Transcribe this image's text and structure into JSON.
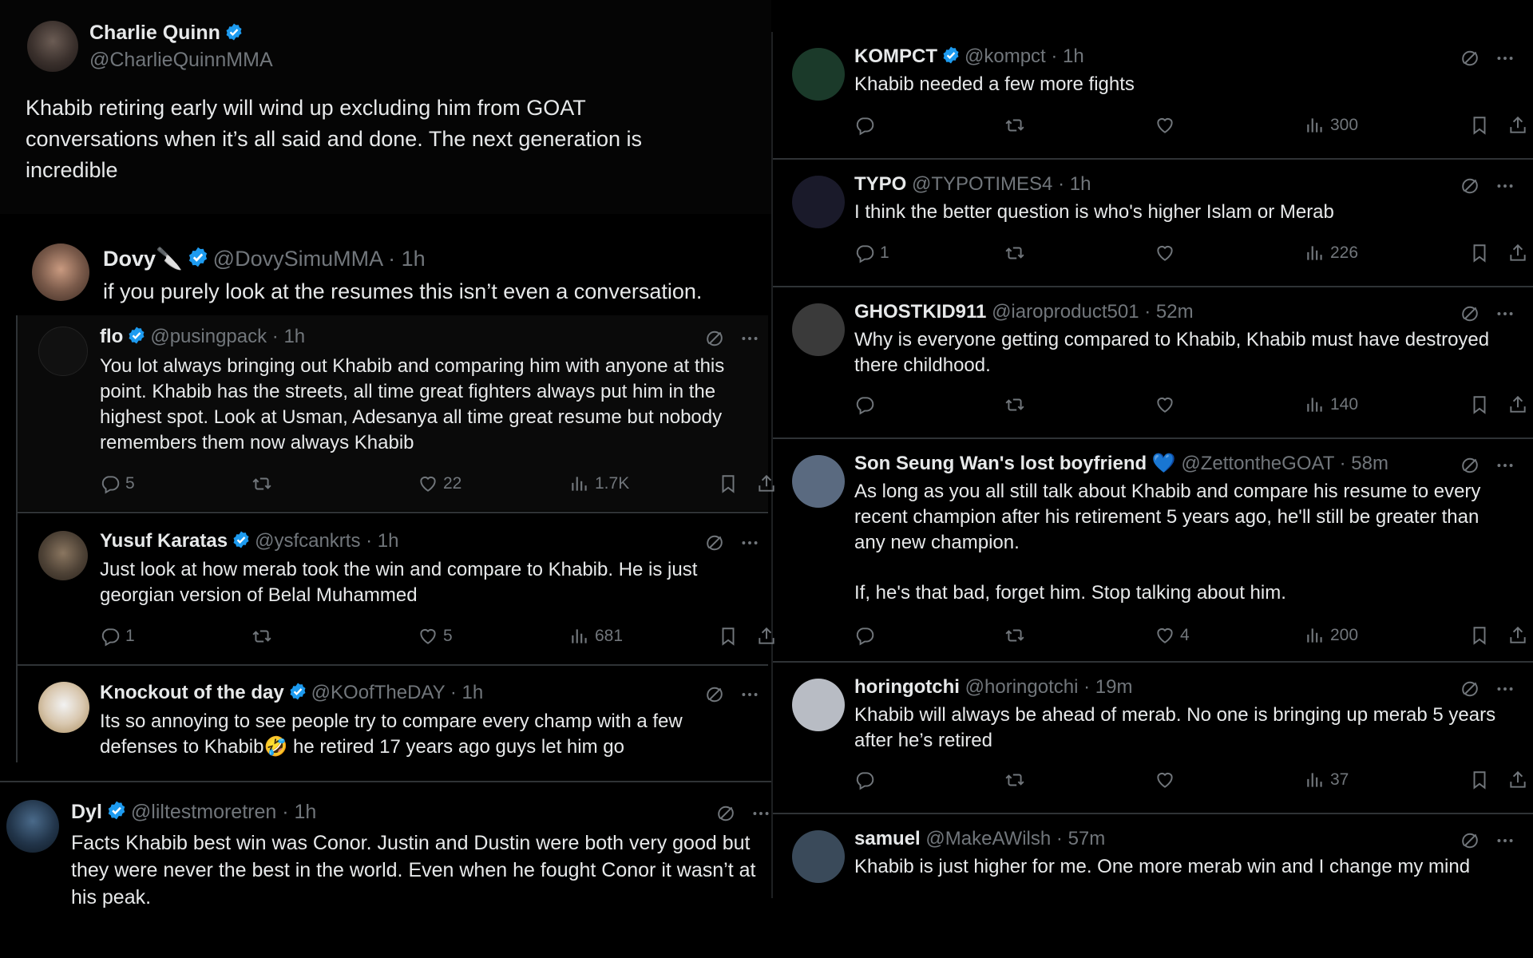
{
  "main_post": {
    "name": "Charlie Quinn",
    "handle": "@CharlieQuinnMMA",
    "text": "Khabib retiring early will wind up excluding him from GOAT conversations when it’s all said and done. The next generation is incredible"
  },
  "dovy": {
    "name": "Dovy🔪",
    "handle": "@DovySimuMMA",
    "time": "1h",
    "text": "if you purely look at the resumes this isn’t even a conversation."
  },
  "left_replies": [
    {
      "name": "flo",
      "handle": "@pusingpack",
      "time": "1h",
      "text": "You lot always bringing out Khabib and comparing him with anyone at this point. Khabib has the streets, all time great fighters always put him in the highest spot. Look at Usman, Adesanya all time great resume but nobody remembers them now always Khabib",
      "replies": "5",
      "retweets": "",
      "likes": "22",
      "views": "1.7K"
    },
    {
      "name": "Yusuf Karatas",
      "handle": "@ysfcankrts",
      "time": "1h",
      "text": "Just look at how merab took the win and compare to Khabib. He is just georgian version of Belal Muhammed",
      "replies": "1",
      "retweets": "",
      "likes": "5",
      "views": "681"
    },
    {
      "name": "Knockout of the day",
      "handle": "@KOofTheDAY",
      "time": "1h",
      "text": "Its so annoying to see people try to compare every champ with a few defenses to Khabib🤣 he retired 17 years ago guys let him go"
    }
  ],
  "dyl": {
    "name": "Dyl",
    "handle": "@liltestmoretren",
    "time": "1h",
    "text": "Facts Khabib best win was Conor. Justin and Dustin were both very good but they were never the best in the world. Even when he fought Conor it wasn’t at his peak."
  },
  "right_replies": [
    {
      "name": "KOMPCT",
      "verified": true,
      "handle": "@kompct",
      "time": "1h",
      "text": "Khabib needed a few more fights",
      "replies": "",
      "likes": "",
      "views": "300"
    },
    {
      "name": "TYPO",
      "verified": false,
      "handle": "@TYPOTIMES4",
      "time": "1h",
      "text": "I think the better question is who's higher Islam or Merab",
      "replies": "1",
      "likes": "",
      "views": "226"
    },
    {
      "name": "GHOSTKID911",
      "verified": false,
      "handle": "@iaroproduct501",
      "time": "52m",
      "text": "Why is everyone getting compared to Khabib, Khabib must have destroyed there childhood.",
      "replies": "",
      "likes": "",
      "views": "140"
    },
    {
      "name": "Son Seung Wan's lost boyfriend 💙",
      "verified": false,
      "handle": "@ZettontheGOAT",
      "time": "58m",
      "text": "As long as you all still talk about Khabib and compare his resume to every recent champion after his retirement 5 years ago, he'll still be greater than any new champion.",
      "text2": "If, he's that bad, forget him. Stop talking about him.",
      "replies": "",
      "likes": "4",
      "views": "200"
    },
    {
      "name": "horingotchi",
      "verified": false,
      "handle": "@horingotchi",
      "time": "19m",
      "text": "Khabib will always be ahead of merab. No one is bringing up merab 5 years after he’s retired",
      "replies": "",
      "likes": "",
      "views": "37"
    },
    {
      "name": "samuel",
      "verified": false,
      "handle": "@MakeAWilsh",
      "time": "57m",
      "text": "Khabib is just higher for me. One more merab win and I change my mind"
    }
  ],
  "colors": {
    "background": "#000000",
    "text": "#e7e9ea",
    "muted": "#71767b",
    "verified": "#1d9bf0",
    "heart_emoji": "#5da8ff"
  },
  "icons": [
    "verified-badge-icon",
    "grok-icon",
    "more-icon",
    "reply-icon",
    "retweet-icon",
    "like-icon",
    "views-icon",
    "bookmark-icon",
    "share-icon"
  ]
}
